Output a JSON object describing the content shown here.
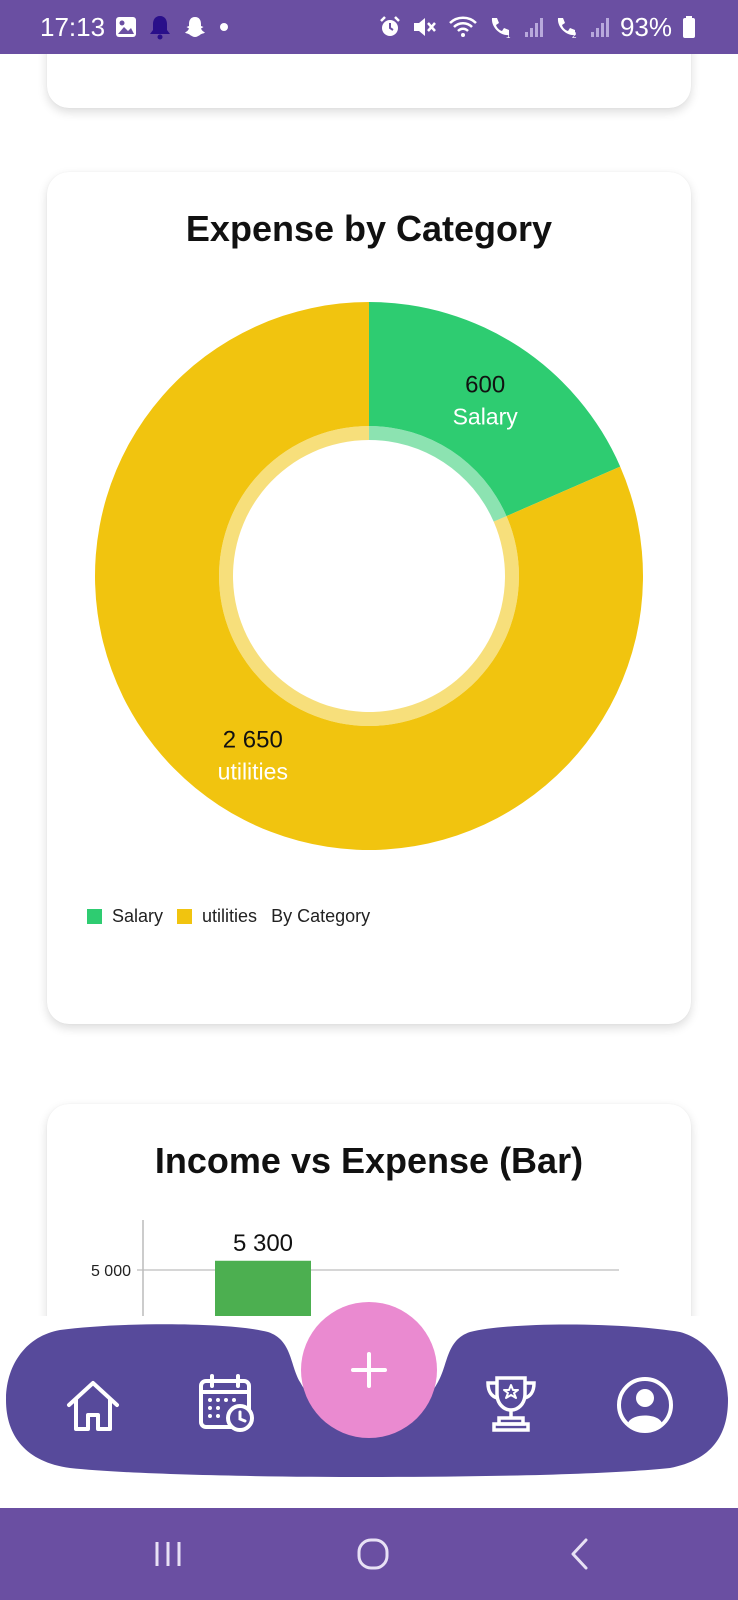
{
  "status_bar": {
    "time": "17:13",
    "battery_percent": "93%",
    "left_icons": [
      "gallery-icon",
      "notification-bell-icon",
      "snapchat-ghost-icon",
      "dot-icon"
    ],
    "right_icons": [
      "alarm-icon",
      "mute-icon",
      "wifi-icon",
      "volte-call-1-icon",
      "signal-1-icon",
      "volte-call-2-icon",
      "signal-2-icon",
      "battery-icon"
    ]
  },
  "pie_card": {
    "title": "Expense by Category",
    "legend_extra": "By Category"
  },
  "bar_card": {
    "title": "Income vs Expense (Bar)"
  },
  "chart_data": [
    {
      "type": "pie",
      "title": "Expense by Category",
      "donut": true,
      "categories": [
        "Salary",
        "utilities"
      ],
      "values": [
        600,
        2650
      ],
      "value_labels": [
        "600",
        "2 650"
      ],
      "colors": [
        "#2ecc71",
        "#f1c40f"
      ],
      "legend": {
        "position": "bottom-left",
        "entries": [
          "Salary",
          "utilities",
          "By Category"
        ]
      }
    },
    {
      "type": "bar",
      "title": "Income vs Expense (Bar)",
      "visible_values": [
        5300
      ],
      "value_labels": [
        "5 300"
      ],
      "y_ticks_visible": [
        "5 000"
      ],
      "y_tick_values": [
        5000
      ],
      "colors": [
        "#4caf50"
      ],
      "grid": true
    }
  ],
  "bottom_nav": {
    "items": [
      "home-icon",
      "calendar-clock-icon",
      "trophy-icon",
      "profile-icon"
    ],
    "fab_icon": "plus-icon",
    "background": "#574a9b",
    "fab_color": "#ea8ad0"
  },
  "system_nav": {
    "buttons": [
      "recents-icon",
      "home-circle-icon",
      "back-icon"
    ]
  }
}
